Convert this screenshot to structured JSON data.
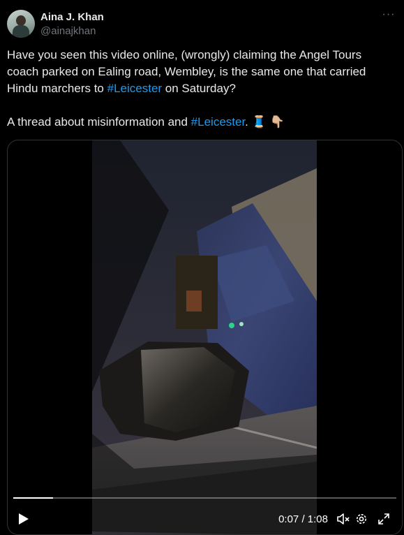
{
  "author": {
    "name": "Aina J. Khan",
    "handle": "@ainajkhan",
    "avatar_icon": "profile-avatar",
    "more_icon": "more-options-icon"
  },
  "tweet": {
    "line1_prefix": "Have you seen this video online, (wrongly) claiming the Angel Tours coach parked on Ealing road, Wembley, is the same one that carried Hindu marchers to ",
    "line1_hashtag": "#Leicester",
    "line1_suffix": " on Saturday?",
    "line2_prefix": "A thread about misinformation and ",
    "line2_hashtag": "#Leicester",
    "line2_suffix": ". 🧵 👇🏼"
  },
  "video": {
    "current_time": "0:07",
    "separator": " / ",
    "duration": "1:08",
    "progress_fraction": 0.103,
    "icons": {
      "play": "play-icon",
      "mute": "mute-icon",
      "settings": "gear-icon",
      "fullscreen": "fullscreen-icon"
    }
  },
  "colors": {
    "background": "#000000",
    "text": "#e7e9ea",
    "secondary_text": "#71767b",
    "link": "#1d9bf0",
    "border": "#2f3336"
  }
}
